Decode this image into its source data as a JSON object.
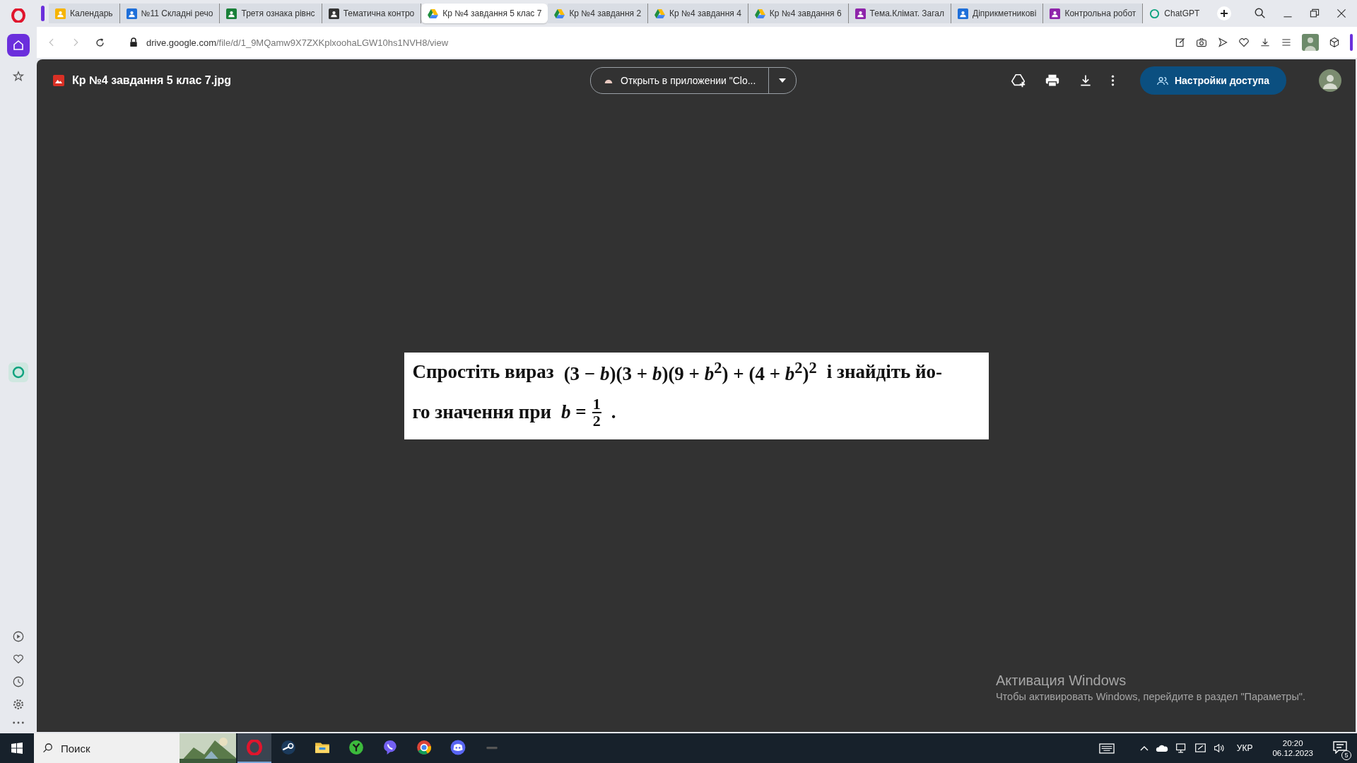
{
  "tabs": [
    {
      "label": "Календарь",
      "kind": "classroom",
      "color": "#f6b400",
      "selected": false
    },
    {
      "label": "№11 Складні речо",
      "kind": "classroom",
      "color": "#1e6fd9",
      "selected": false
    },
    {
      "label": "Третя ознака рівнс",
      "kind": "classroom",
      "color": "#188038",
      "selected": false
    },
    {
      "label": "Тематична контро",
      "kind": "classroom",
      "color": "#333333",
      "selected": false
    },
    {
      "label": "Кр №4 завдання 5 клас 7",
      "kind": "drive",
      "selected": true
    },
    {
      "label": "Кр №4 завдання 2",
      "kind": "drive",
      "selected": false
    },
    {
      "label": "Кр №4 завдання 4",
      "kind": "drive",
      "selected": false
    },
    {
      "label": "Кр №4 завдання 6",
      "kind": "drive",
      "selected": false
    },
    {
      "label": "Тема.Клімат. Загал",
      "kind": "classroom",
      "color": "#8e24aa",
      "selected": false
    },
    {
      "label": "Діприкметникові",
      "kind": "classroom",
      "color": "#1e6fd9",
      "selected": false
    },
    {
      "label": "Контрольна робот",
      "kind": "classroom",
      "color": "#8e24aa",
      "selected": false
    },
    {
      "label": "ChatGPT",
      "kind": "chatgpt",
      "color": "#10a37f",
      "selected": false
    }
  ],
  "address": {
    "host": "drive.google.com",
    "path": "/file/d/1_9MQamw9X7ZXKplxoohaLGW10hs1NVH8/view"
  },
  "sidebar": {
    "items": [
      {
        "kind": "home",
        "selected": true
      },
      {
        "kind": "star",
        "selected": false
      }
    ]
  },
  "viewer": {
    "file_name": "Кр №4 завдання 5 клас 7.jpg",
    "open_button": "Открыть в приложении \"Clo...",
    "share_button": "Настройки доступа"
  },
  "document": {
    "line1_text": "Спростіть вираз",
    "line1_math": "(3 − *b*)(3 + *b*)(9 + *b*$^{2}$) + (4 + *b*$^{2}$)$^{2}$",
    "line1_end": "і знайдіть йо-",
    "line2_text": "го значення при",
    "variable": "*b* =",
    "numerator": "1",
    "denominator": "2",
    "line2_end": "."
  },
  "activation": {
    "title": "Активация Windows",
    "message": "Чтобы активировать Windows, перейдите в раздел \"Параметры\"."
  },
  "taskbar": {
    "search_placeholder": "Поиск",
    "language": "УКР",
    "time": "20:20",
    "date": "06.12.2023",
    "notifications": "5"
  }
}
